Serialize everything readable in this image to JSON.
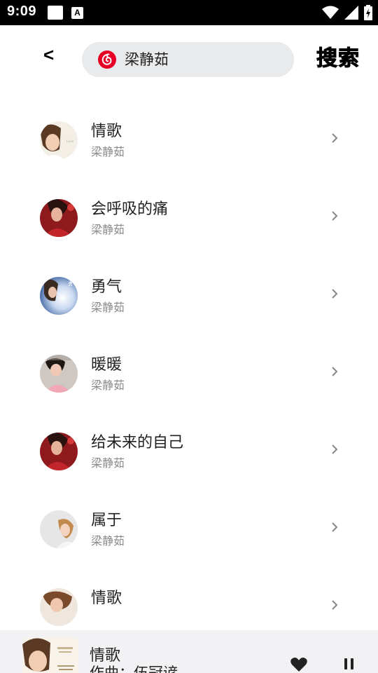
{
  "status_bar": {
    "time": "9:09",
    "notification_letter": "A"
  },
  "header": {
    "back_label": "<",
    "search_value": "梁静茹",
    "search_button_label": "搜索"
  },
  "songs": [
    {
      "title": "情歌",
      "artist": "梁静茹"
    },
    {
      "title": "会呼吸的痛",
      "artist": "梁静茹"
    },
    {
      "title": "勇气",
      "artist": "梁静茹"
    },
    {
      "title": "暖暖",
      "artist": "梁静茹"
    },
    {
      "title": "给未来的自己",
      "artist": "梁静茹"
    },
    {
      "title": "属于",
      "artist": "梁静茹"
    },
    {
      "title": "情歌",
      "artist": ""
    }
  ],
  "mini_player": {
    "title": "情歌",
    "subtitle": "作曲：伍冠谚"
  },
  "colors": {
    "brand_red": "#e60026",
    "search_bg": "#e9eaec",
    "player_bg": "#f2f2f4"
  }
}
